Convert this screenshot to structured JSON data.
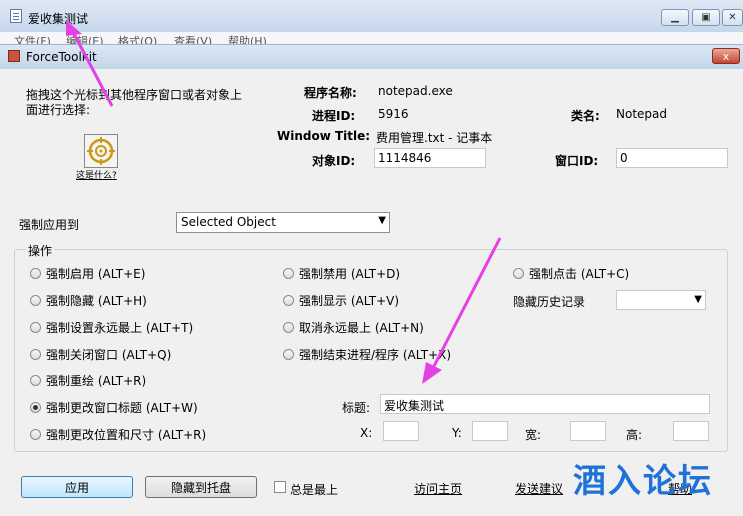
{
  "notepad": {
    "title": "爱收集测试",
    "menus": [
      "文件(F)",
      "编辑(E)",
      "格式(O)",
      "查看(V)",
      "帮助(H)"
    ]
  },
  "dialog": {
    "title": "ForceToolkit",
    "close_glyph": "x"
  },
  "drag": {
    "instruction_line1": "拖拽这个光标到其他程序窗口或者对象上",
    "instruction_line2": "面进行选择:",
    "what_link": "这是什么?"
  },
  "info": {
    "program_label": "程序名称:",
    "program_value": "notepad.exe",
    "pid_label": "进程ID:",
    "pid_value": "5916",
    "class_label": "类名:",
    "class_value": "Notepad",
    "wtitle_label": "Window Title:",
    "wtitle_value": "费用管理.txt - 记事本",
    "objid_label": "对象ID:",
    "objid_value": "1114846",
    "winid_label": "窗口ID:",
    "winid_value": "0"
  },
  "apply_to": {
    "label": "强制应用到",
    "selected": "Selected Object"
  },
  "ops": {
    "title": "操作",
    "col1": [
      {
        "label": "强制启用 (ALT+E)",
        "checked": false
      },
      {
        "label": "强制隐藏 (ALT+H)",
        "checked": false
      },
      {
        "label": "强制设置永远最上 (ALT+T)",
        "checked": false
      },
      {
        "label": "强制关闭窗口 (ALT+Q)",
        "checked": false
      },
      {
        "label": "强制重绘 (ALT+R)",
        "checked": false
      },
      {
        "label": "强制更改窗口标题 (ALT+W)",
        "checked": true
      },
      {
        "label": "强制更改位置和尺寸 (ALT+R)",
        "checked": false
      }
    ],
    "col2": [
      {
        "label": "强制禁用 (ALT+D)",
        "checked": false
      },
      {
        "label": "强制显示 (ALT+V)",
        "checked": false
      },
      {
        "label": "取消永远最上 (ALT+N)",
        "checked": false
      },
      {
        "label": "强制结束进程/程序 (ALT+X)",
        "checked": false
      }
    ],
    "col3": [
      {
        "label": "强制点击 (ALT+C)",
        "checked": false
      }
    ],
    "hide_history_label": "隐藏历史记录",
    "title_label": "标题:",
    "title_value": "爱收集测试",
    "x_label": "X:",
    "y_label": "Y:",
    "w_label": "宽:",
    "h_label": "高:"
  },
  "footer": {
    "apply_button": "应用",
    "tray_button": "隐藏到托盘",
    "topmost_label": "总是最上",
    "home_link": "访问主页",
    "feedback_link": "发送建议",
    "help_link": "帮助"
  },
  "watermark": "酒入论坛",
  "colors": {
    "annotation_arrow": "#e540e5",
    "watermark": "#1f72d8"
  }
}
